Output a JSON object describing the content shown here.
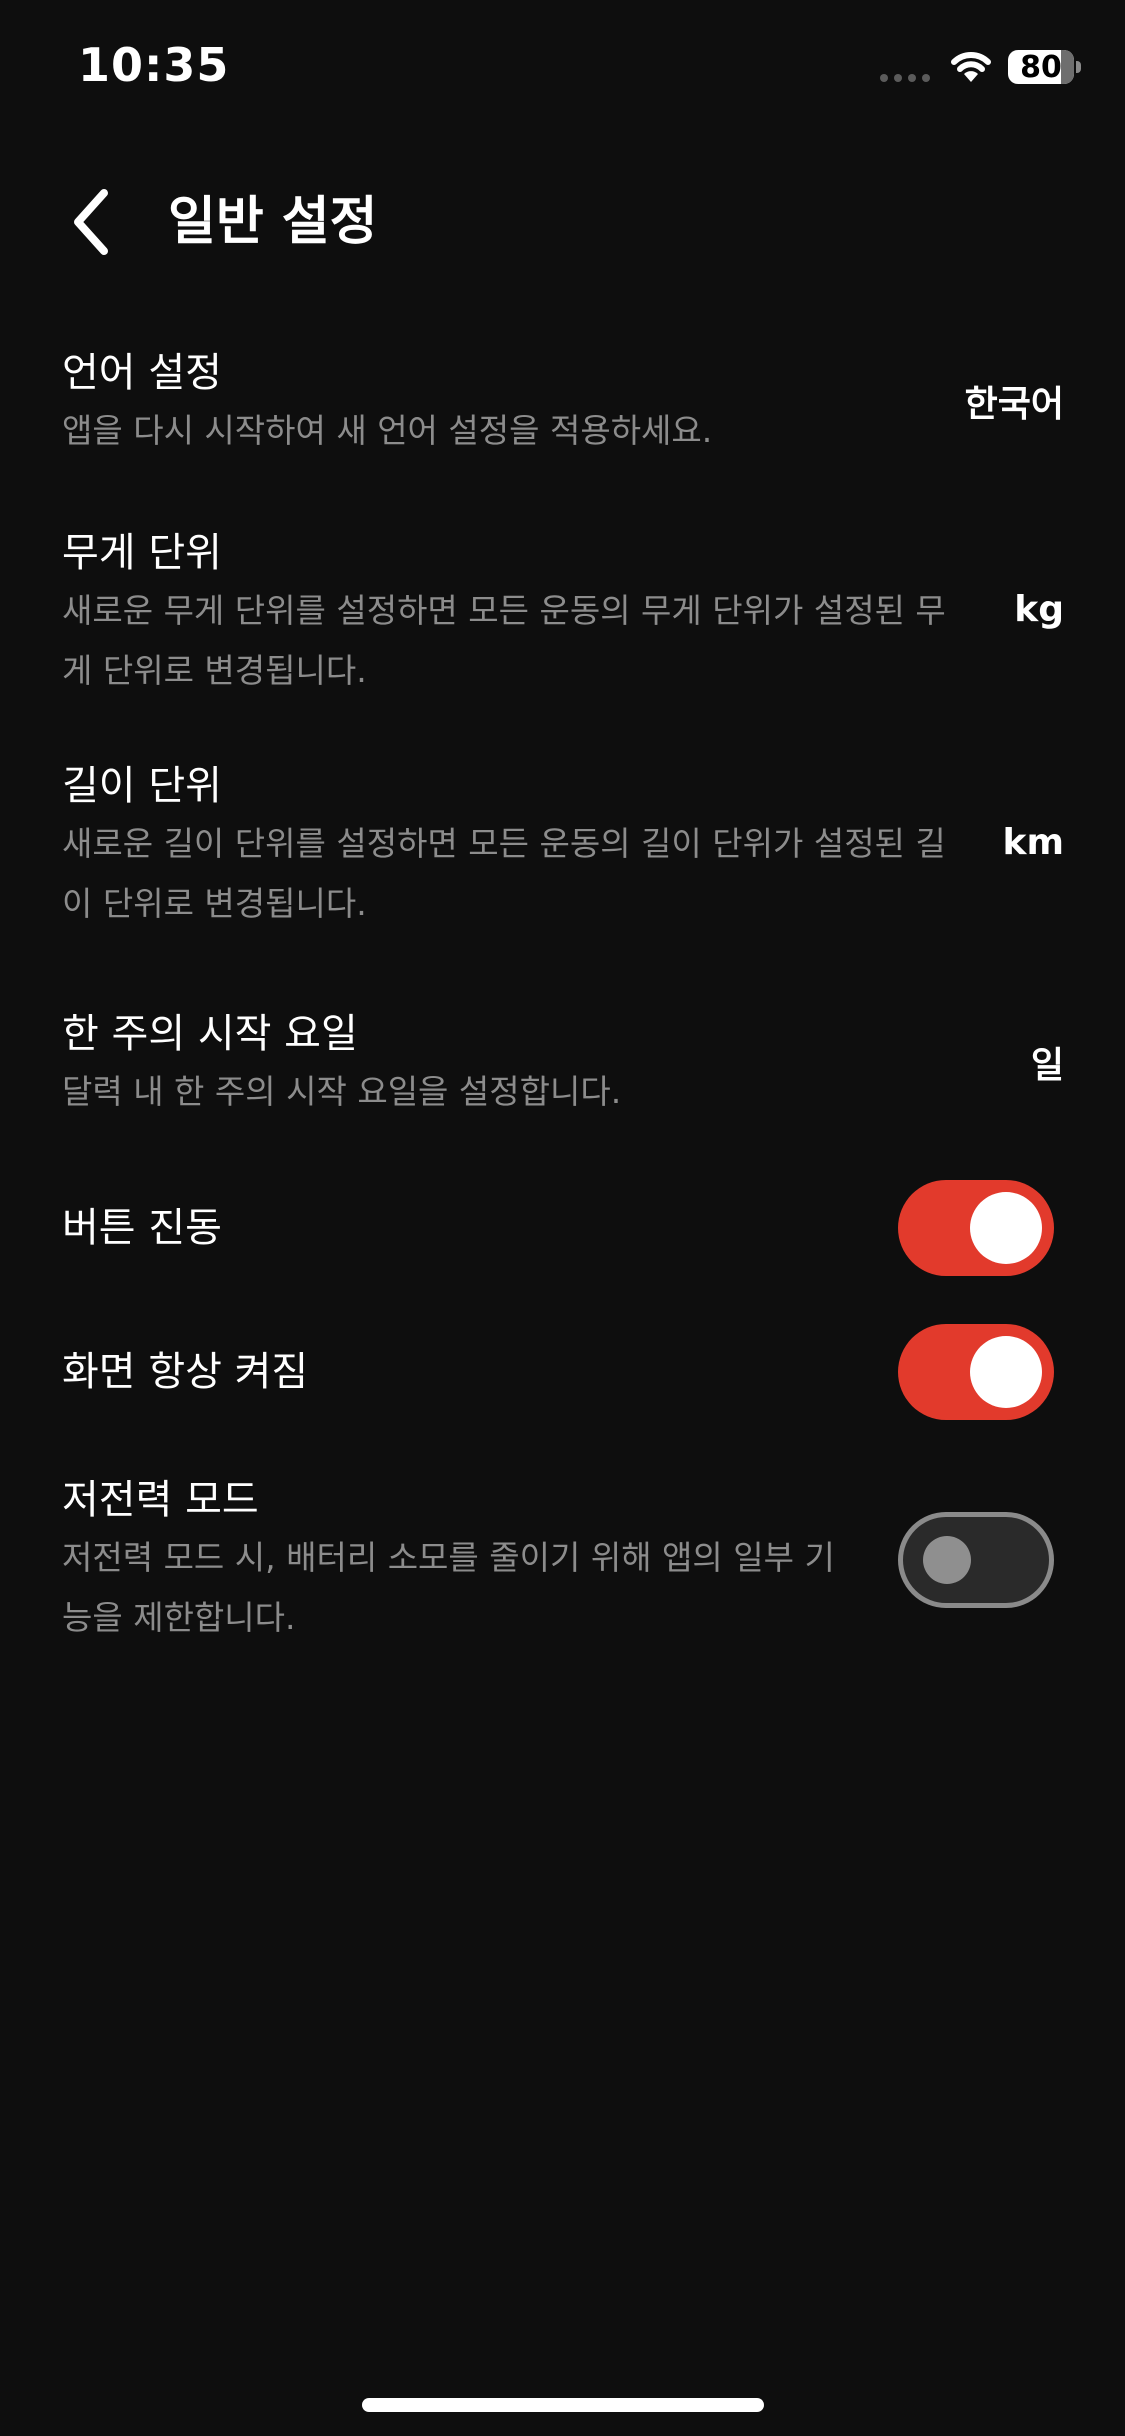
{
  "status_bar": {
    "time": "10:35",
    "battery_percent": 80
  },
  "header": {
    "title": "일반 설정",
    "back_icon": "chevron-left-icon"
  },
  "settings": [
    {
      "title": "언어 설정",
      "description": "앱을 다시 시작하여 새 언어 설정을 적용하세요.",
      "value": "한국어"
    },
    {
      "title": "무게 단위",
      "description": "새로운 무게 단위를 설정하면 모든 운동의 무게 단위가 설정된 무게 단위로 변경됩니다.",
      "value": "kg"
    },
    {
      "title": "길이 단위",
      "description": "새로운 길이 단위를 설정하면 모든 운동의 길이 단위가 설정된 길이 단위로 변경됩니다.",
      "value": "km"
    },
    {
      "title": "한 주의 시작 요일",
      "description": "달력 내 한 주의 시작 요일을 설정합니다.",
      "value": "일"
    }
  ],
  "toggles": [
    {
      "title": "버튼 진동",
      "enabled": true
    },
    {
      "title": "화면 항상 켜짐",
      "enabled": true
    },
    {
      "title": "저전력 모드",
      "description": "저전력 모드 시, 배터리 소모를 줄이기 위해 앱의 일부 기능을 제한합니다.",
      "enabled": false
    }
  ],
  "colors": {
    "accent": "#e23a2c",
    "background": "#0e0e0e",
    "secondary_text": "#8c8c8c"
  }
}
